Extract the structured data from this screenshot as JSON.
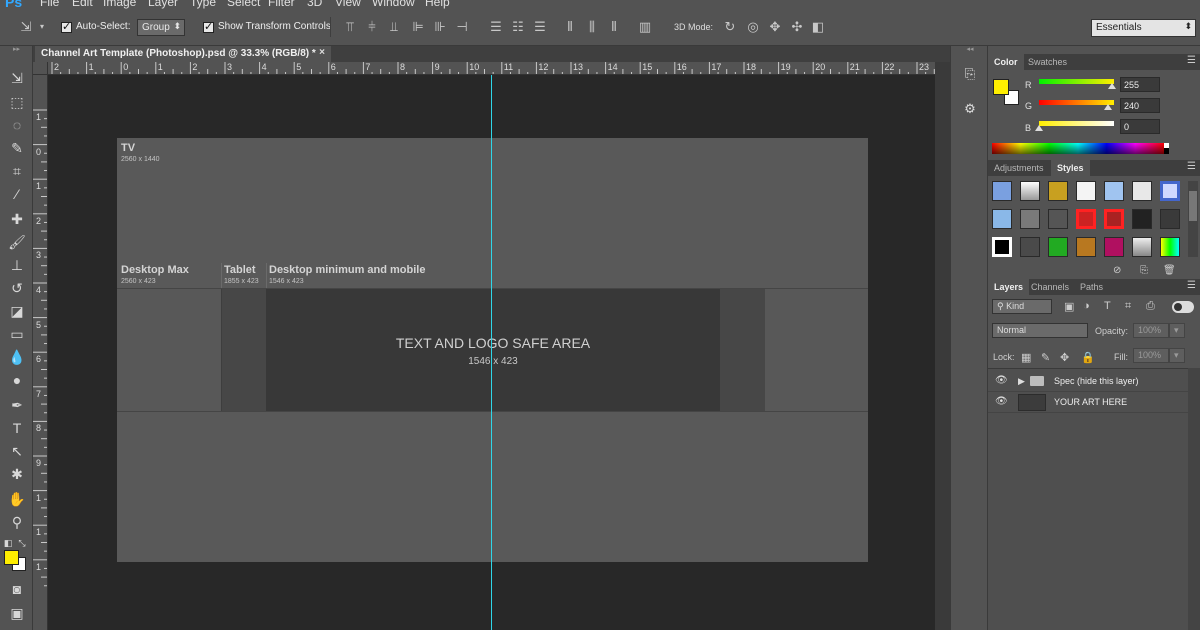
{
  "app": {
    "logo": "Ps",
    "menu": [
      "File",
      "Edit",
      "Image",
      "Layer",
      "Type",
      "Select",
      "Filter",
      "3D",
      "View",
      "Window",
      "Help"
    ]
  },
  "options_bar": {
    "auto_select_label": "Auto-Select:",
    "auto_select_checked": true,
    "auto_select_value": "Group",
    "show_transform_label": "Show Transform Controls",
    "show_transform_checked": true,
    "mode_3d_label": "3D Mode:",
    "workspace": "Essentials"
  },
  "document": {
    "tab_title": "Channel Art Template (Photoshop).psd @ 33.3% (RGB/8) *",
    "close_glyph": "×",
    "ruler_top_ticks": [
      "2",
      "1",
      "0",
      "1",
      "2",
      "3",
      "4",
      "5",
      "6",
      "7",
      "8",
      "9",
      "10",
      "11",
      "12",
      "13",
      "14",
      "15",
      "16",
      "17",
      "18",
      "19",
      "20",
      "21",
      "22",
      "23"
    ],
    "ruler_left_ticks": [
      "1",
      "0",
      "1",
      "2",
      "3",
      "4",
      "5",
      "6",
      "7",
      "8",
      "9",
      "1",
      "1",
      "1"
    ]
  },
  "canvas": {
    "tv_label": "TV",
    "tv_dim": "2560 x 1440",
    "desktop_max_label": "Desktop Max",
    "desktop_max_dim": "2560 x 423",
    "tablet_label": "Tablet",
    "tablet_dim": "1855 x 423",
    "mobile_label": "Desktop minimum and mobile",
    "mobile_dim": "1546 x 423",
    "safe_area_title": "TEXT AND LOGO SAFE AREA",
    "safe_area_dim": "1546 x 423",
    "guide_color": "#2fd6e8"
  },
  "color_panel": {
    "tabs": [
      "Color",
      "Swatches"
    ],
    "foreground": "#ffee00",
    "background": "#ffffff",
    "channels": [
      {
        "label": "R",
        "value": "255",
        "level": 1.0
      },
      {
        "label": "G",
        "value": "240",
        "level": 0.94
      },
      {
        "label": "B",
        "value": "0",
        "level": 0.0
      }
    ]
  },
  "styles_panel": {
    "tabs": [
      "Adjustments",
      "Styles"
    ]
  },
  "layers_panel": {
    "tabs": [
      "Layers",
      "Channels",
      "Paths"
    ],
    "filter_kind": "Kind",
    "blend_mode": "Normal",
    "opacity_label": "Opacity:",
    "opacity_value": "100%",
    "lock_label": "Lock:",
    "fill_label": "Fill:",
    "fill_value": "100%",
    "layers": [
      {
        "name": "Spec (hide this layer)",
        "type": "group"
      },
      {
        "name": "YOUR ART HERE",
        "type": "layer"
      }
    ]
  }
}
